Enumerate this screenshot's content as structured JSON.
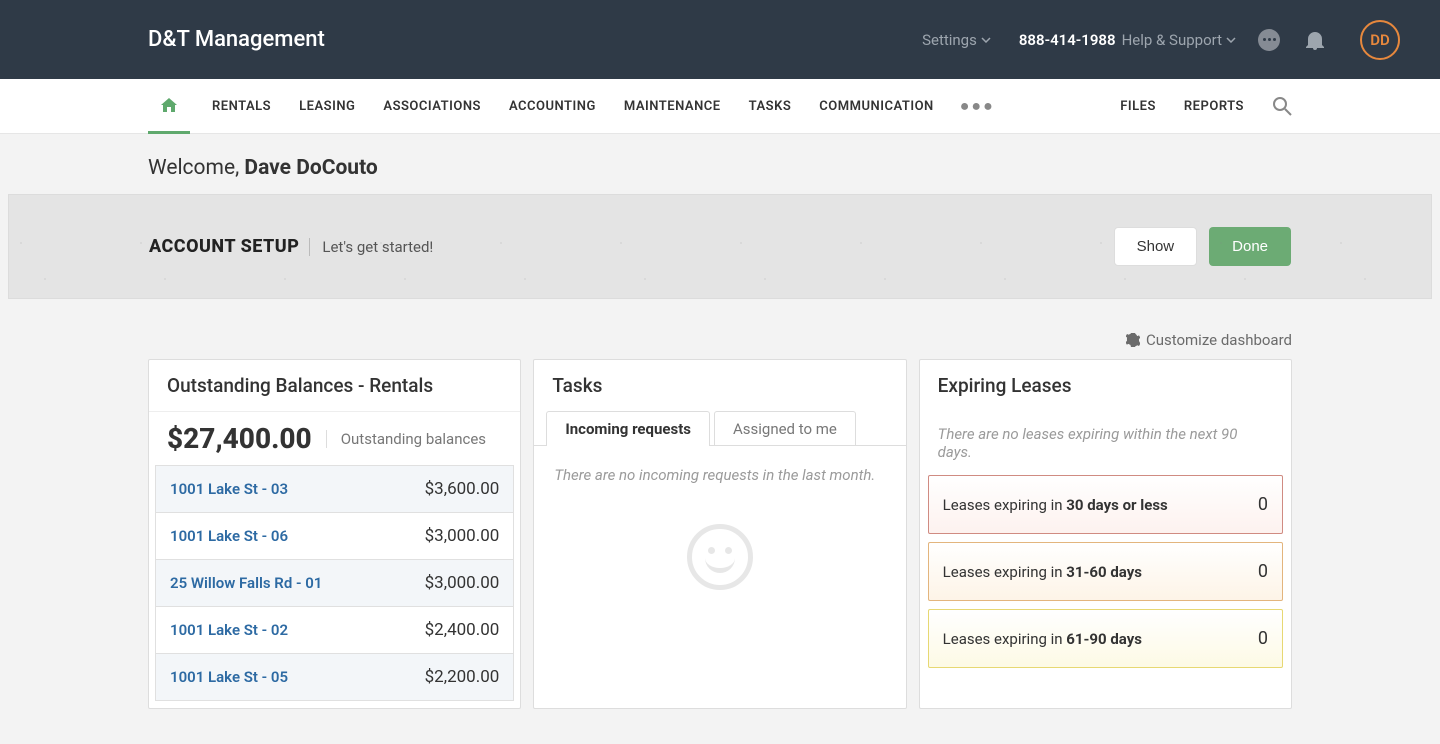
{
  "header": {
    "brand": "D&T Management",
    "settings": "Settings",
    "phone": "888-414-1988",
    "help": "Help & Support",
    "avatar_initials": "DD"
  },
  "nav": {
    "items": [
      "RENTALS",
      "LEASING",
      "ASSOCIATIONS",
      "ACCOUNTING",
      "MAINTENANCE",
      "TASKS",
      "COMMUNICATION"
    ],
    "files": "FILES",
    "reports": "REPORTS"
  },
  "welcome": {
    "prefix": "Welcome, ",
    "name": "Dave DoCouto"
  },
  "setup": {
    "title": "ACCOUNT SETUP",
    "sub": "Let's get started!",
    "show": "Show",
    "done": "Done"
  },
  "customize": "Customize dashboard",
  "outstanding": {
    "title": "Outstanding Balances - Rentals",
    "total": "$27,400.00",
    "total_label": "Outstanding balances",
    "rows": [
      {
        "addr": "1001 Lake St - 03",
        "amt": "$3,600.00"
      },
      {
        "addr": "1001 Lake St - 06",
        "amt": "$3,000.00"
      },
      {
        "addr": "25 Willow Falls Rd - 01",
        "amt": "$3,000.00"
      },
      {
        "addr": "1001 Lake St - 02",
        "amt": "$2,400.00"
      },
      {
        "addr": "1001 Lake St - 05",
        "amt": "$2,200.00"
      }
    ]
  },
  "tasks": {
    "title": "Tasks",
    "tab_incoming": "Incoming requests",
    "tab_assigned": "Assigned to me",
    "empty_msg": "There are no incoming requests in the last month."
  },
  "expiring": {
    "title": "Expiring Leases",
    "note": "There are no leases expiring within the next 90 days.",
    "r1_prefix": "Leases expiring in ",
    "r1_strong": "30 days or less",
    "r1_count": "0",
    "r2_prefix": "Leases expiring in ",
    "r2_strong": "31-60 days",
    "r2_count": "0",
    "r3_prefix": "Leases expiring in ",
    "r3_strong": "61-90 days",
    "r3_count": "0"
  }
}
